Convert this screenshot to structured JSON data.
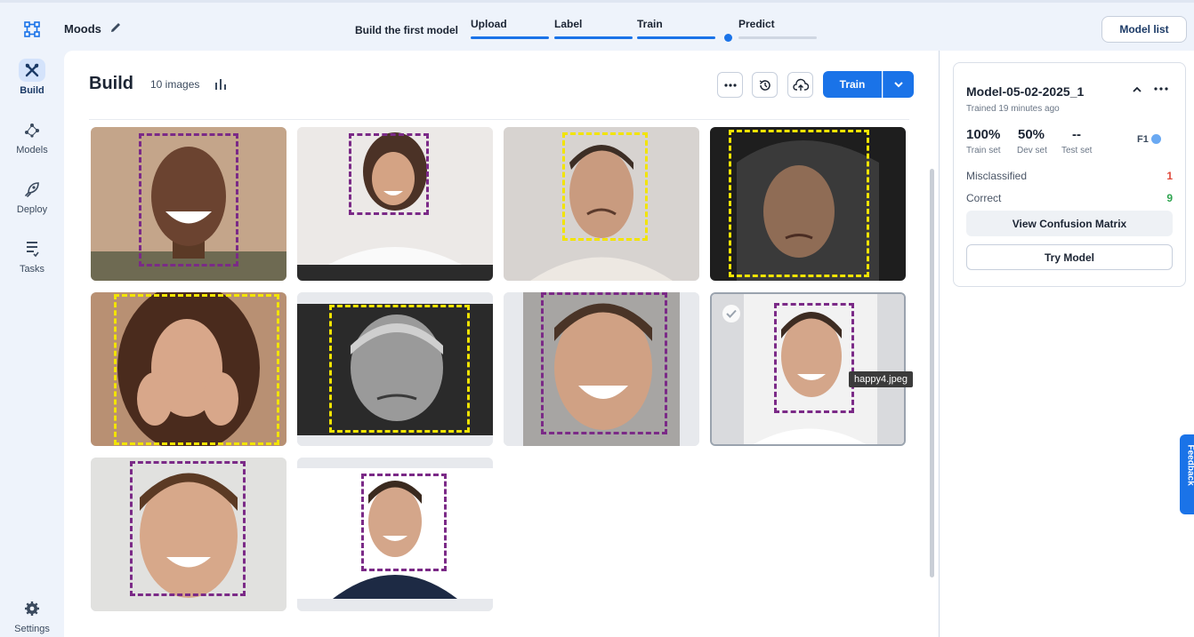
{
  "topbar": {
    "project_name": "Moods",
    "workflow_label": "Build the first model",
    "steps": [
      {
        "label": "Upload",
        "state": "done"
      },
      {
        "label": "Label",
        "state": "done"
      },
      {
        "label": "Train",
        "state": "done"
      },
      {
        "label": "Predict",
        "state": "current"
      }
    ],
    "model_list_label": "Model list"
  },
  "nav": {
    "items": [
      {
        "label": "Build",
        "icon": "tools-icon",
        "active": true
      },
      {
        "label": "Models",
        "icon": "models-icon",
        "active": false
      },
      {
        "label": "Deploy",
        "icon": "rocket-icon",
        "active": false
      },
      {
        "label": "Tasks",
        "icon": "tasks-icon",
        "active": false
      }
    ],
    "settings_label": "Settings"
  },
  "build": {
    "title": "Build",
    "image_count": "10 images",
    "train_label": "Train",
    "tooltip": "happy4.jpeg"
  },
  "images": [
    {
      "id": "img-1",
      "label_color": "#7b2a87",
      "mood": "happy"
    },
    {
      "id": "img-2",
      "label_color": "#7b2a87",
      "mood": "happy"
    },
    {
      "id": "img-3",
      "label_color": "#f2e400",
      "mood": "sad"
    },
    {
      "id": "img-4",
      "label_color": "#f2e400",
      "mood": "sad"
    },
    {
      "id": "img-5",
      "label_color": "#f2e400",
      "mood": "sad"
    },
    {
      "id": "img-6",
      "label_color": "#f2e400",
      "mood": "sad"
    },
    {
      "id": "img-7",
      "label_color": "#7b2a87",
      "mood": "happy"
    },
    {
      "id": "img-8",
      "label_color": "#7b2a87",
      "mood": "happy",
      "selected": true
    },
    {
      "id": "img-9",
      "label_color": "#7b2a87",
      "mood": "happy"
    },
    {
      "id": "img-10",
      "label_color": "#7b2a87",
      "mood": "happy"
    }
  ],
  "model_card": {
    "name": "Model-05-02-2025_1",
    "trained_ago": "Trained 19 minutes ago",
    "train_set_value": "100%",
    "train_set_label": "Train set",
    "dev_set_value": "50%",
    "dev_set_label": "Dev set",
    "test_set_value": "--",
    "test_set_label": "Test set",
    "metric_label": "F1",
    "misclassified_label": "Misclassified",
    "misclassified_value": "1",
    "correct_label": "Correct",
    "correct_value": "9",
    "confusion_btn": "View Confusion Matrix",
    "try_btn": "Try Model"
  },
  "feedback_label": "Feedback",
  "colors": {
    "accent": "#1a73e8",
    "happy_label": "#7b2a87",
    "sad_label": "#f2e400",
    "misclassified": "#e0483a",
    "correct": "#2ea44f"
  }
}
